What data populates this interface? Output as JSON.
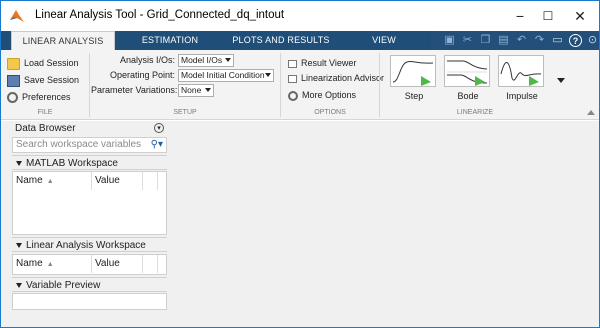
{
  "window": {
    "title": "Linear Analysis Tool - Grid_Connected_dq_intout",
    "controls": {
      "minimize": "−",
      "maximize": "☐",
      "close": "✕"
    }
  },
  "tabs": [
    {
      "label": "LINEAR ANALYSIS",
      "active": true
    },
    {
      "label": "ESTIMATION",
      "active": false
    },
    {
      "label": "PLOTS AND RESULTS",
      "active": false
    },
    {
      "label": "VIEW",
      "active": false
    }
  ],
  "quick_access_icons": [
    "save-icon",
    "cut-icon",
    "copy-icon",
    "paste-icon",
    "undo-icon",
    "redo-icon",
    "split-icon",
    "help-icon",
    "options-icon"
  ],
  "file_section": {
    "label": "FILE",
    "load_session": "Load Session",
    "save_session": "Save Session",
    "preferences": "Preferences"
  },
  "setup_section": {
    "label": "SETUP",
    "analysis_ios_label": "Analysis I/Os:",
    "analysis_ios_value": "Model I/Os",
    "operating_point_label": "Operating Point:",
    "operating_point_value": "Model Initial Condition",
    "param_variations_label": "Parameter Variations:",
    "param_variations_value": "None"
  },
  "options_section": {
    "label": "OPTIONS",
    "result_viewer": "Result Viewer",
    "linearization_advisor": "Linearization Advisor",
    "more_options": "More Options"
  },
  "linearize_section": {
    "label": "LINEARIZE",
    "step": "Step",
    "bode": "Bode",
    "impulse": "Impulse"
  },
  "data_browser": {
    "title": "Data Browser",
    "search_placeholder": "Search workspace variables",
    "matlab_workspace": {
      "title": "MATLAB Workspace",
      "col_name": "Name",
      "col_value": "Value"
    },
    "linear_analysis_workspace": {
      "title": "Linear Analysis Workspace",
      "col_name": "Name",
      "col_value": "Value"
    },
    "variable_preview": {
      "title": "Variable Preview"
    }
  },
  "colors": {
    "tab_bar": "#1f4e79",
    "toolstrip": "#f3f3f3",
    "window_border": "#1979ca",
    "matlab_orange": "#e8761f",
    "plot_green": "#4fb848"
  }
}
